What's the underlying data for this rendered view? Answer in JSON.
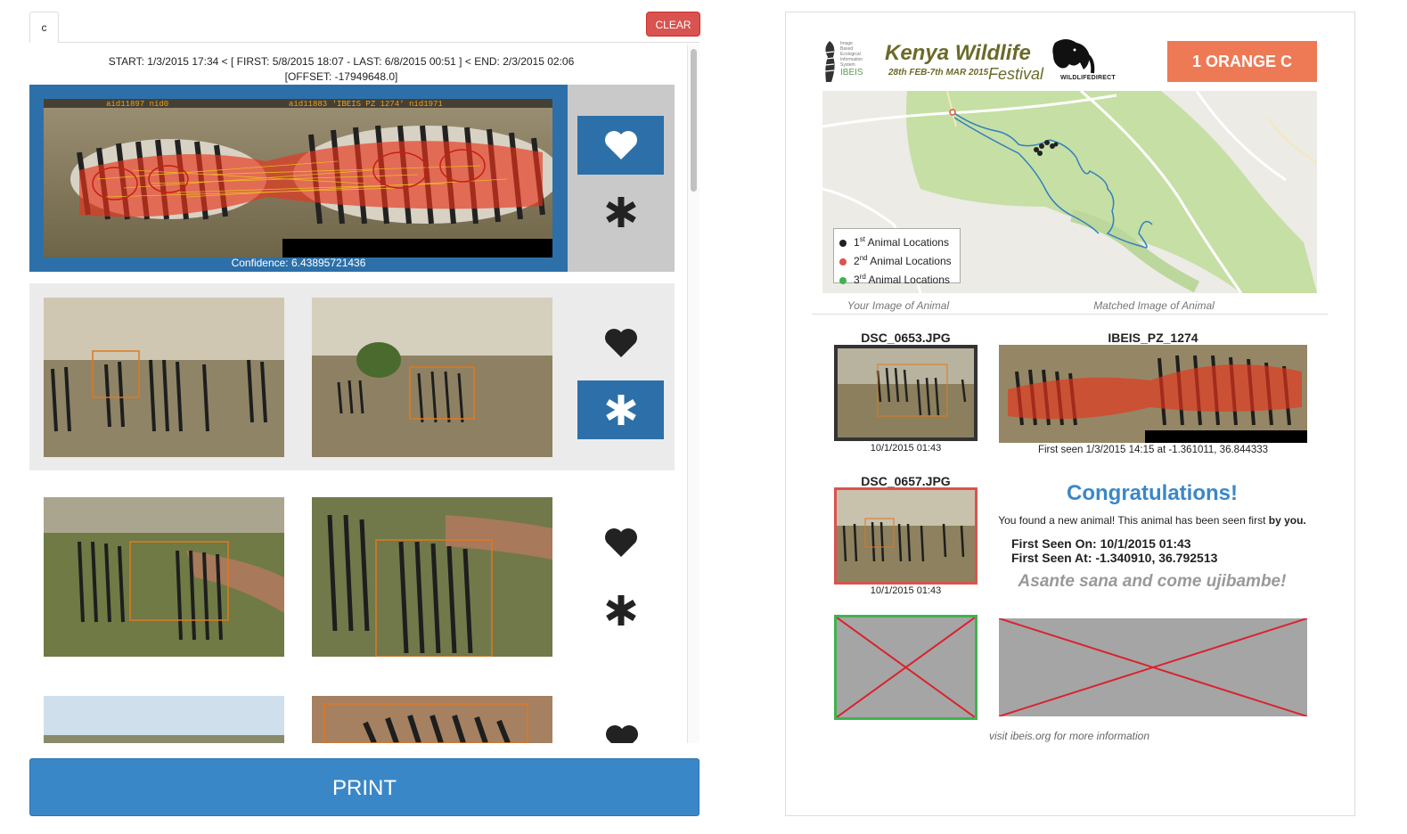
{
  "left_panel": {
    "tab_label": "c",
    "clear_button": "CLEAR",
    "header_line1": "START: 1/3/2015 17:34 < [ FIRST: 5/8/2015 18:07 - LAST: 6/8/2015 00:51 ] < END: 2/3/2015 02:06",
    "header_line2": "[OFFSET: -17949648.0]",
    "match_overlay_left": "aid11897  nid0",
    "match_overlay_right": "aid11883 'IBEIS PZ 1274' nid1971",
    "confidence": "Confidence: 6.43895721436",
    "print_button": "PRINT"
  },
  "icons": {
    "favorite": "heart-icon",
    "asterisk": "asterisk-icon"
  },
  "colors": {
    "primary": "#2d70a9",
    "danger": "#d9534f",
    "accent": "#ee7955",
    "print": "#3a87c8"
  },
  "card": {
    "logo_lines": [
      "Image",
      "Based",
      "Ecological",
      "Information",
      "System",
      "IBEIS"
    ],
    "festival_title": "Kenya Wildlife",
    "festival_dates": "28th FEB-7th MAR 2015",
    "festival_word": "Festival",
    "wildlife_logo": "WILDLIFEDIRECT",
    "badge": "1 ORANGE C",
    "legend": [
      {
        "ord": "1",
        "sup": "st",
        "text": "Animal Locations",
        "color": "#222222"
      },
      {
        "ord": "2",
        "sup": "nd",
        "text": "Animal Locations",
        "color": "#d9534f"
      },
      {
        "ord": "3",
        "sup": "rd",
        "text": "Animal Locations",
        "color": "#3fb34f"
      }
    ],
    "caption_yours": "Your Image of Animal",
    "caption_matched": "Matched Image of Animal",
    "image1_name": "DSC_0653.JPG",
    "image1_time": "10/1/2015 01:43",
    "matched_name": "IBEIS_PZ_1274",
    "matched_info": "First seen 1/3/2015 14:15 at -1.361011, 36.844333",
    "image2_name": "DSC_0657.JPG",
    "image2_time": "10/1/2015 01:43",
    "congrats": "Congratulations!",
    "found_text": "You found a new animal! This animal has been seen first",
    "found_bold": "by you.",
    "first_seen_on": "First Seen On: 10/1/2015 01:43",
    "first_seen_at": "First Seen At: -1.340910, 36.792513",
    "asante": "Asante sana and come ujibambe!",
    "visit": "visit ibeis.org for more information"
  }
}
